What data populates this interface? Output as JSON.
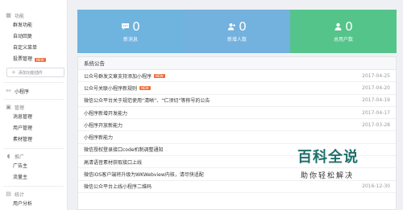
{
  "sidebar": {
    "features_header": "功能",
    "features": [
      {
        "label": "群发功能",
        "new": false
      },
      {
        "label": "自动回复",
        "new": false
      },
      {
        "label": "自定义菜单",
        "new": false
      },
      {
        "label": "投票管理",
        "new": true
      }
    ],
    "new_badge": "NEW",
    "add_plugin": "添加功能插件",
    "mini_program": "小程序",
    "manage_header": "管理",
    "manage": [
      {
        "label": "消息管理"
      },
      {
        "label": "用户管理"
      },
      {
        "label": "素材管理"
      }
    ],
    "promo_header": "推广",
    "promo": [
      {
        "label": "广告主"
      },
      {
        "label": "流量主"
      }
    ],
    "stats_header": "统计",
    "stats": [
      {
        "label": "用户分析"
      }
    ]
  },
  "stats": {
    "new_messages": {
      "value": "0",
      "label": "新消息"
    },
    "new_users": {
      "value": "0",
      "label": "新增人数"
    },
    "total_users": {
      "value": "0",
      "label": "总用户数"
    },
    "colors": {
      "c1": "#6fb3df",
      "c2": "#73b1de",
      "c3": "#55c48a"
    }
  },
  "notices": {
    "title": "系统公告",
    "items": [
      {
        "title": "公众号群发文章支持添加小程序",
        "date": "2017-04-25",
        "new": true
      },
      {
        "title": "公众号关联小程序新规则",
        "date": "2017-04-20",
        "new": true
      },
      {
        "title": "微信公众平台关于规范使用“清晰”、“仁须切”等称号的公告",
        "date": "2017-04-19",
        "new": false
      },
      {
        "title": "小程序新增开发能力",
        "date": "2017-04-17",
        "new": false
      },
      {
        "title": "小程序开放新能力",
        "date": "2017-03-28",
        "new": false
      },
      {
        "title": "小程序新能力",
        "date": "",
        "new": false
      },
      {
        "title": "微信授权登录接口code机制调整通知",
        "date": "",
        "new": false
      },
      {
        "title": "高清语音素材获取接口上线",
        "date": "",
        "new": false
      },
      {
        "title": "微信iOS客户端将升级为WKWebview内核，请尽快适配",
        "date": "",
        "new": false
      },
      {
        "title": "微信公众平台上线小程序二维码",
        "date": "2016-12-30",
        "new": false
      }
    ]
  },
  "watermark": {
    "title": "百科全说",
    "subtitle": "助你轻松解决"
  }
}
